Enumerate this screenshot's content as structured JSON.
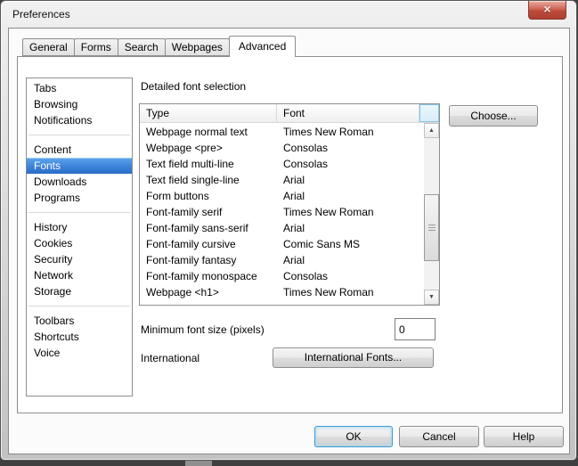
{
  "window": {
    "title": "Preferences"
  },
  "icons": {
    "close": "×",
    "scroll_up": "▲",
    "scroll_down": "▼"
  },
  "tabs": [
    {
      "label": "General"
    },
    {
      "label": "Forms"
    },
    {
      "label": "Search"
    },
    {
      "label": "Webpages"
    },
    {
      "label": "Advanced"
    }
  ],
  "active_tab": "Advanced",
  "sidebar": {
    "selected": "Fonts",
    "items": [
      {
        "label": "Tabs"
      },
      {
        "label": "Browsing"
      },
      {
        "label": "Notifications"
      },
      {
        "label": "Content"
      },
      {
        "label": "Fonts"
      },
      {
        "label": "Downloads"
      },
      {
        "label": "Programs"
      },
      {
        "label": "History"
      },
      {
        "label": "Cookies"
      },
      {
        "label": "Security"
      },
      {
        "label": "Network"
      },
      {
        "label": "Storage"
      },
      {
        "label": "Toolbars"
      },
      {
        "label": "Shortcuts"
      },
      {
        "label": "Voice"
      }
    ]
  },
  "content": {
    "section_label": "Detailed font selection",
    "table": {
      "headers": [
        {
          "label": "Type"
        },
        {
          "label": "Font"
        }
      ],
      "rows": [
        {
          "type": "Webpage normal text",
          "font": "Times New Roman"
        },
        {
          "type": "Webpage <pre>",
          "font": "Consolas"
        },
        {
          "type": "Text field multi-line",
          "font": "Consolas"
        },
        {
          "type": "Text field single-line",
          "font": "Arial"
        },
        {
          "type": "Form buttons",
          "font": "Arial"
        },
        {
          "type": "Font-family serif",
          "font": "Times New Roman"
        },
        {
          "type": "Font-family sans-serif",
          "font": "Arial"
        },
        {
          "type": "Font-family cursive",
          "font": "Comic Sans MS"
        },
        {
          "type": "Font-family fantasy",
          "font": "Arial"
        },
        {
          "type": "Font-family monospace",
          "font": "Consolas"
        },
        {
          "type": "Webpage <h1>",
          "font": "Times New Roman"
        }
      ]
    },
    "choose_button": "Choose...",
    "min_font_size": {
      "label": "Minimum font size (pixels)",
      "value": "0"
    },
    "international": {
      "label": "International",
      "button": "International Fonts..."
    }
  },
  "footer": {
    "ok": "OK",
    "cancel": "Cancel",
    "help": "Help"
  },
  "colors": {
    "selection_top": "#5FA8EA",
    "selection_bottom": "#2B6CC9",
    "close_button_red": "#BC4B3C",
    "ok_focus_blue": "#3C9BD5",
    "header_hover_blue": "#D7EEFC"
  }
}
